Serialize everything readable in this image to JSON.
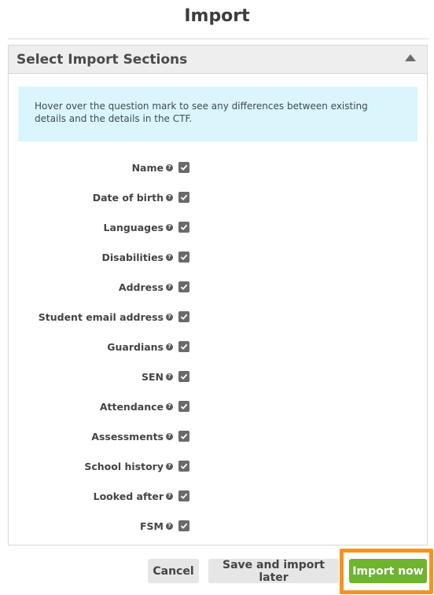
{
  "dialog": {
    "title": "Import"
  },
  "panel": {
    "header": "Select Import Sections",
    "info": "Hover over the question mark to see any differences between existing details and the details in the CTF."
  },
  "sections": [
    {
      "label": "Name",
      "checked": true
    },
    {
      "label": "Date of birth",
      "checked": true
    },
    {
      "label": "Languages",
      "checked": true
    },
    {
      "label": "Disabilities",
      "checked": true
    },
    {
      "label": "Address",
      "checked": true
    },
    {
      "label": "Student email address",
      "checked": true
    },
    {
      "label": "Guardians",
      "checked": true
    },
    {
      "label": "SEN",
      "checked": true
    },
    {
      "label": "Attendance",
      "checked": true
    },
    {
      "label": "Assessments",
      "checked": true
    },
    {
      "label": "School history",
      "checked": true
    },
    {
      "label": "Looked after",
      "checked": true
    },
    {
      "label": "FSM",
      "checked": true
    }
  ],
  "buttons": {
    "cancel": "Cancel",
    "save_later": "Save and import later",
    "import_now": "Import now"
  },
  "colors": {
    "primary": "#6eb42d",
    "highlight": "#f7921e",
    "info_bg": "#daf6fc"
  },
  "icons": {
    "help": "question-mark-icon",
    "collapse": "caret-up-icon",
    "check": "checkmark-icon"
  }
}
